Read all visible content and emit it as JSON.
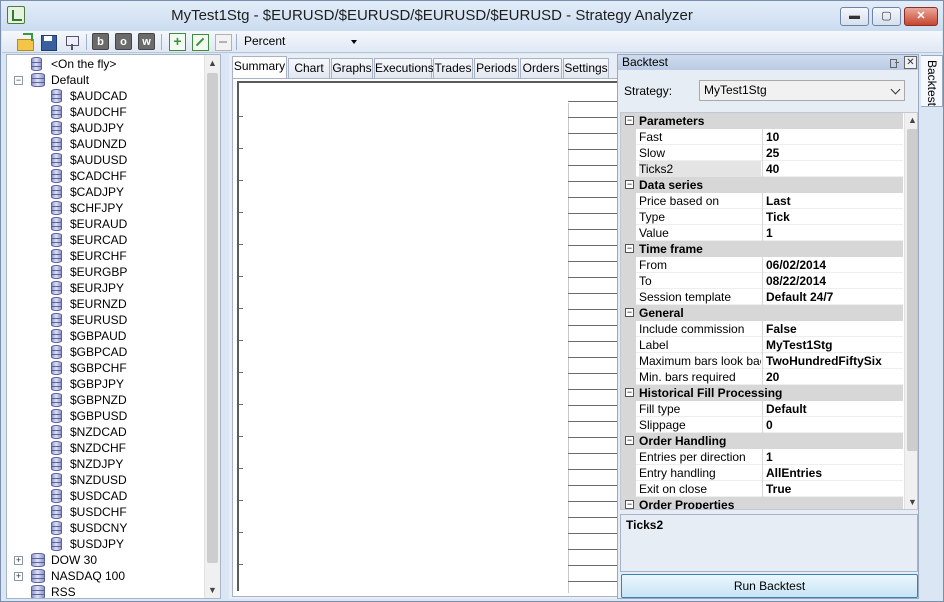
{
  "window": {
    "title": "MyTest1Stg - $EURUSD/$EURUSD/$EURUSD/$EURUSD - Strategy Analyzer",
    "min_glyph": "▬",
    "max_glyph": "▢",
    "close_glyph": "✕"
  },
  "toolbar": {
    "b_label": "b",
    "o_label": "o",
    "w_label": "w",
    "display_unit": "Percent"
  },
  "tree": {
    "items": [
      {
        "label": "<On the fly>"
      },
      {
        "label": "Default"
      },
      {
        "label": "$AUDCAD"
      },
      {
        "label": "$AUDCHF"
      },
      {
        "label": "$AUDJPY"
      },
      {
        "label": "$AUDNZD"
      },
      {
        "label": "$AUDUSD"
      },
      {
        "label": "$CADCHF"
      },
      {
        "label": "$CADJPY"
      },
      {
        "label": "$CHFJPY"
      },
      {
        "label": "$EURAUD"
      },
      {
        "label": "$EURCAD"
      },
      {
        "label": "$EURCHF"
      },
      {
        "label": "$EURGBP"
      },
      {
        "label": "$EURJPY"
      },
      {
        "label": "$EURNZD"
      },
      {
        "label": "$EURUSD"
      },
      {
        "label": "$GBPAUD"
      },
      {
        "label": "$GBPCAD"
      },
      {
        "label": "$GBPCHF"
      },
      {
        "label": "$GBPJPY"
      },
      {
        "label": "$GBPNZD"
      },
      {
        "label": "$GBPUSD"
      },
      {
        "label": "$NZDCAD"
      },
      {
        "label": "$NZDCHF"
      },
      {
        "label": "$NZDJPY"
      },
      {
        "label": "$NZDUSD"
      },
      {
        "label": "$USDCAD"
      },
      {
        "label": "$USDCHF"
      },
      {
        "label": "$USDCNY"
      },
      {
        "label": "$USDJPY"
      },
      {
        "label": "DOW 30"
      },
      {
        "label": "NASDAQ 100"
      },
      {
        "label": "RSS"
      }
    ]
  },
  "tabs": [
    "Summary",
    "Chart",
    "Graphs",
    "Executions",
    "Trades",
    "Periods",
    "Orders",
    "Settings"
  ],
  "backtest": {
    "panel_title": "Backtest",
    "side_tab": "Backtest",
    "strategy_label": "Strategy:",
    "strategy_value": "MyTest1Stg",
    "categories": [
      {
        "name": "Parameters",
        "rows": [
          {
            "name": "Fast",
            "value": "10"
          },
          {
            "name": "Slow",
            "value": "25"
          },
          {
            "name": "Ticks2",
            "value": "40"
          }
        ]
      },
      {
        "name": "Data series",
        "rows": [
          {
            "name": "Price based on",
            "value": "Last"
          },
          {
            "name": "Type",
            "value": "Tick"
          },
          {
            "name": "Value",
            "value": "1"
          }
        ]
      },
      {
        "name": "Time frame",
        "rows": [
          {
            "name": "From",
            "value": "06/02/2014"
          },
          {
            "name": "To",
            "value": "08/22/2014"
          },
          {
            "name": "Session template",
            "value": "Default 24/7"
          }
        ]
      },
      {
        "name": "General",
        "rows": [
          {
            "name": "Include commission",
            "value": "False"
          },
          {
            "name": "Label",
            "value": "MyTest1Stg"
          },
          {
            "name": "Maximum bars look back",
            "value": "TwoHundredFiftySix"
          },
          {
            "name": "Min. bars required",
            "value": "20"
          }
        ]
      },
      {
        "name": "Historical Fill Processing",
        "rows": [
          {
            "name": "Fill type",
            "value": "Default"
          },
          {
            "name": "Slippage",
            "value": "0"
          }
        ]
      },
      {
        "name": "Order Handling",
        "rows": [
          {
            "name": "Entries per direction",
            "value": "1"
          },
          {
            "name": "Entry handling",
            "value": "AllEntries"
          },
          {
            "name": "Exit on close",
            "value": "True"
          }
        ]
      },
      {
        "name": "Order Properties",
        "rows": []
      }
    ],
    "help_title": "Ticks2",
    "run_button": "Run Backtest"
  }
}
